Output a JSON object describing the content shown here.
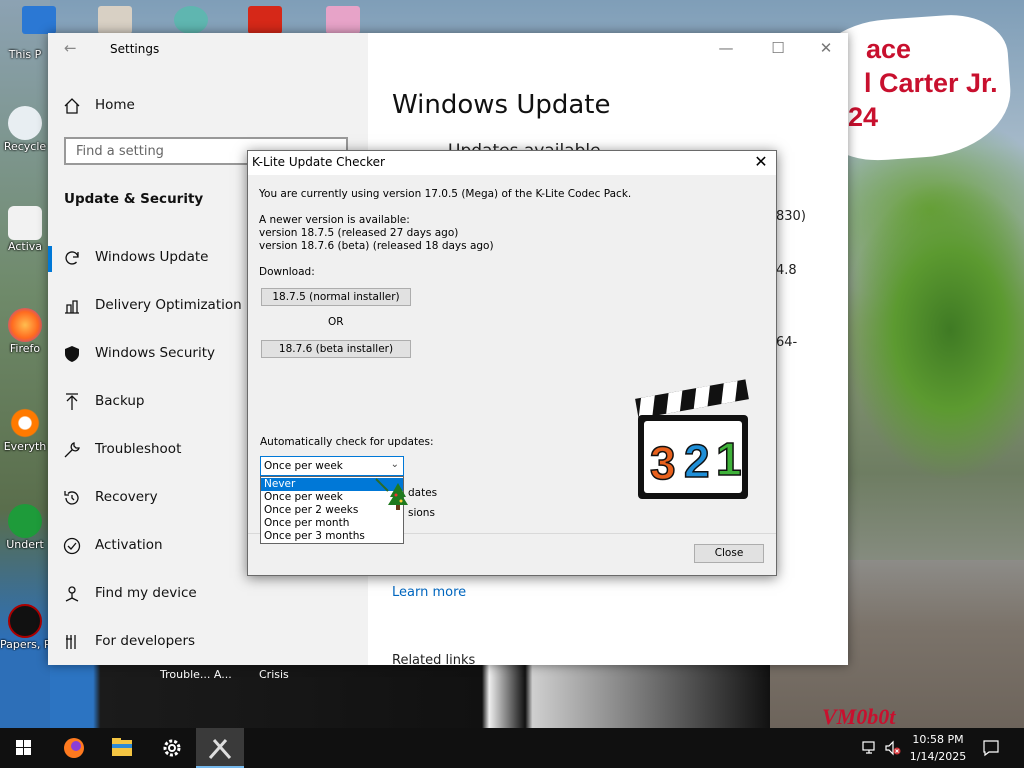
{
  "desktop": {
    "icons": [
      {
        "label": "This P"
      },
      {
        "label": "Recycle"
      },
      {
        "label": "Activa"
      },
      {
        "label": "Firefo"
      },
      {
        "label": "Everyth"
      },
      {
        "label": "Undert"
      },
      {
        "label": "Papers, P"
      }
    ],
    "bottom_labels": [
      "Trouble... A...",
      "Crisis"
    ],
    "sign_lines": [
      "ace",
      "l Carter Jr.",
      "24"
    ],
    "watermark": "VM0b0t"
  },
  "settings": {
    "window_title": "Settings",
    "home_label": "Home",
    "search_placeholder": "Find a setting",
    "section_heading": "Update & Security",
    "nav_items": [
      {
        "label": "Windows Update",
        "icon": "refresh-icon"
      },
      {
        "label": "Delivery Optimization",
        "icon": "delivery-icon"
      },
      {
        "label": "Windows Security",
        "icon": "shield-icon"
      },
      {
        "label": "Backup",
        "icon": "backup-arrow-icon"
      },
      {
        "label": "Troubleshoot",
        "icon": "wrench-icon"
      },
      {
        "label": "Recovery",
        "icon": "recovery-icon"
      },
      {
        "label": "Activation",
        "icon": "check-circle-icon"
      },
      {
        "label": "Find my device",
        "icon": "person-pin-icon"
      },
      {
        "label": "For developers",
        "icon": "developer-icon"
      }
    ],
    "main_title": "Windows Update",
    "partial_texts": [
      "Updates available",
      "830)",
      "4.8",
      "64-"
    ],
    "learn_more": "Learn more",
    "related_links": "Related links"
  },
  "klite_dialog": {
    "title": "K-Lite Update Checker",
    "current_version_text": "You are currently using version 17.0.5 (Mega) of the K-Lite Codec Pack.",
    "newer_available": "A newer version is available:",
    "version_normal": "version 18.7.5  (released 27 days ago)",
    "version_beta": "version 18.7.6  (beta)  (released 18 days ago)",
    "download_label": "Download:",
    "normal_button": "18.7.5 (normal installer)",
    "or_text": "OR",
    "beta_button": "18.7.6 (beta installer)",
    "auto_check_label": "Automatically check for updates:",
    "selected_frequency": "Once per week",
    "frequency_options": [
      "Never",
      "Once per week",
      "Once per 2 weeks",
      "Once per month",
      "Once per 3 months"
    ],
    "highlighted_option": "Never",
    "checkbox_fragments": [
      "dates",
      "sions"
    ],
    "close_button": "Close",
    "logo_digits": [
      "3",
      "2",
      "1"
    ]
  },
  "taskbar": {
    "time": "10:58 PM",
    "date": "1/14/2025"
  }
}
